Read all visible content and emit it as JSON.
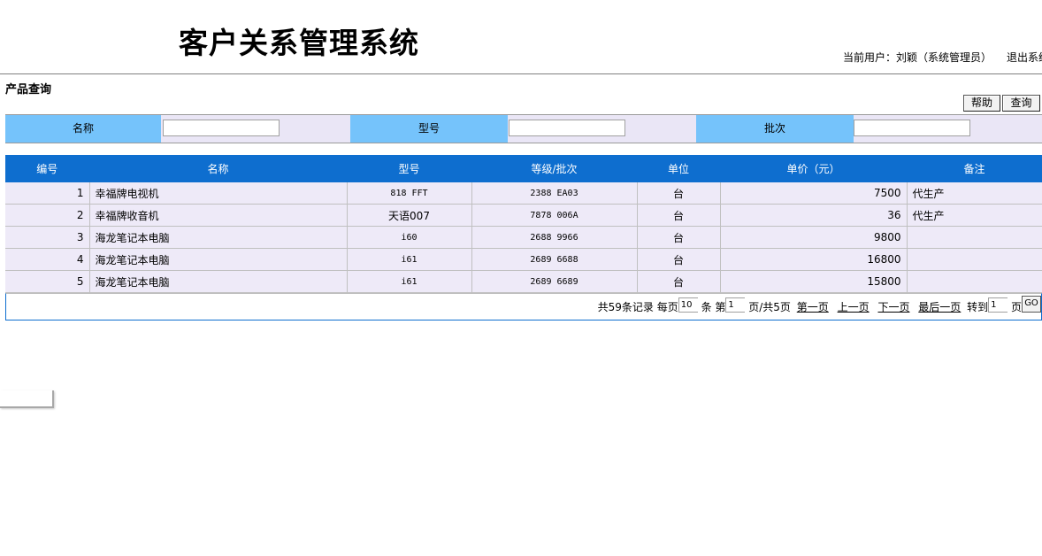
{
  "header": {
    "app_title": "客户关系管理系统",
    "current_user": "当前用户：刘颖（系统管理员）",
    "logout": "退出系统"
  },
  "section": {
    "title": "产品查询"
  },
  "toolbar": {
    "help_label": "帮助",
    "query_label": "查询"
  },
  "search": {
    "name_label": "名称",
    "name_value": "",
    "model_label": "型号",
    "model_value": "",
    "batch_label": "批次",
    "batch_value": ""
  },
  "table": {
    "columns": [
      "编号",
      "名称",
      "型号",
      "等级/批次",
      "单位",
      "单价（元）",
      "备注"
    ],
    "rows": [
      [
        "1",
        "幸福牌电视机",
        "818 FFT",
        "2388 EA03",
        "台",
        "7500",
        "代生产"
      ],
      [
        "2",
        "幸福牌收音机",
        "天语007",
        "7878 006A",
        "台",
        "36",
        "代生产"
      ],
      [
        "3",
        "海龙笔记本电脑",
        "i60",
        "2688 9966",
        "台",
        "9800",
        ""
      ],
      [
        "4",
        "海龙笔记本电脑",
        "i61",
        "2689 6688",
        "台",
        "16800",
        ""
      ],
      [
        "5",
        "海龙笔记本电脑",
        "i61",
        "2689 6689",
        "台",
        "15800",
        ""
      ]
    ]
  },
  "pager": {
    "total": "共59条记录",
    "per_page_prefix": "每页",
    "per_page_value": "10",
    "per_page_suffix": "条",
    "page_prefix": "第",
    "page_value": "1",
    "page_suffix": "页/共5页",
    "first": "第一页",
    "prev": "上一页",
    "next": "下一页",
    "last": "最后一页",
    "goto_prefix": "转到",
    "goto_value": "1",
    "goto_suffix": "页",
    "go_label": "GO"
  },
  "colors": {
    "header_blue": "#0e6ecf",
    "label_blue": "#75c3fb",
    "row_bg": "#eeeaf8"
  }
}
